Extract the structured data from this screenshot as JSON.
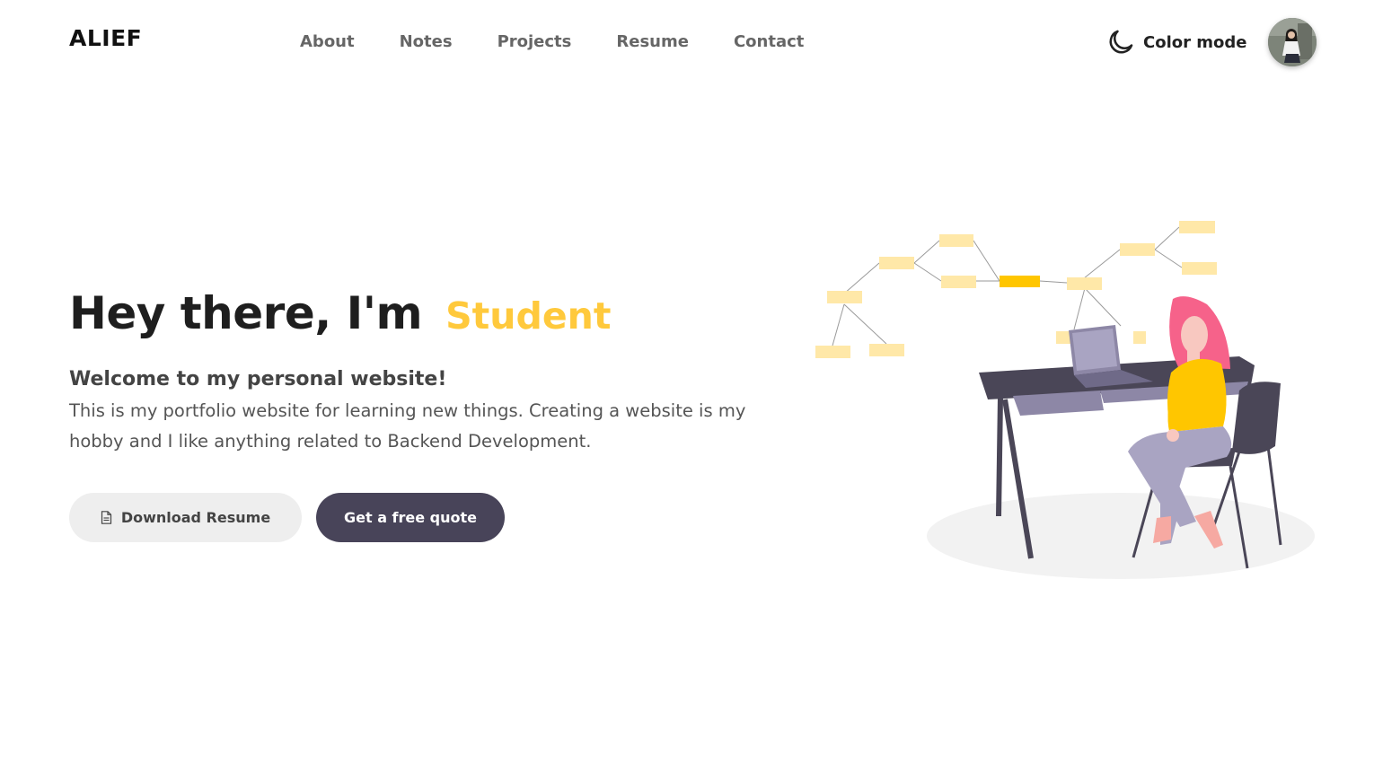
{
  "brand": {
    "logo": "ALIEF"
  },
  "nav": {
    "links": [
      {
        "label": "About"
      },
      {
        "label": "Notes"
      },
      {
        "label": "Projects"
      },
      {
        "label": "Resume"
      },
      {
        "label": "Contact"
      }
    ],
    "color_mode_label": "Color mode",
    "color_mode_icon": "moon-icon"
  },
  "hero": {
    "greeting": "Hey there, I'm",
    "role": "Student",
    "welcome": "Welcome to my personal website!",
    "description": "This is my portfolio website for learning new things. Creating a website is my hobby and I like anything related to Backend Development."
  },
  "buttons": {
    "download_resume": "Download Resume",
    "download_icon": "document-icon",
    "free_quote": "Get a free quote"
  },
  "colors": {
    "accent": "#ffc93c",
    "primary_button": "#484459",
    "secondary_button": "#eeeeee"
  }
}
